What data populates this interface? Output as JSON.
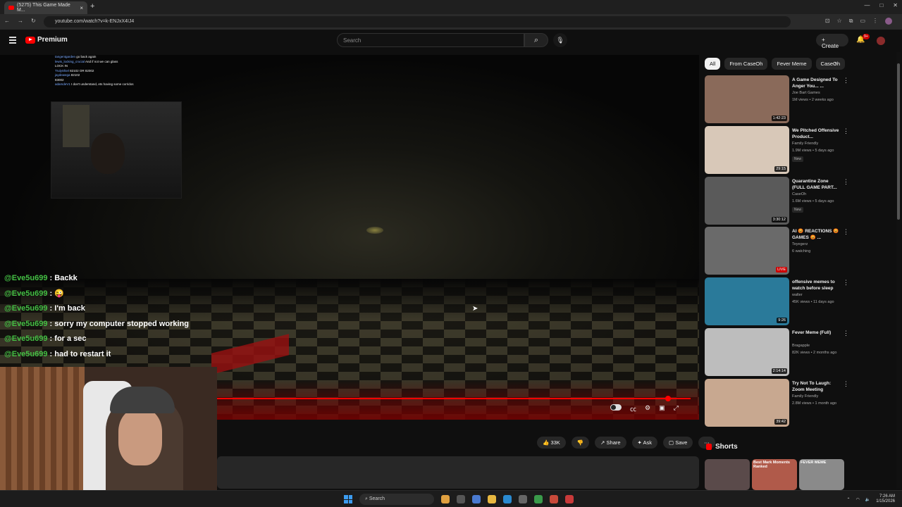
{
  "browser": {
    "tab_title": "(5275) This Game Made M...",
    "url": "youtube.com/watch?v=k-ENJxX4IJ4"
  },
  "header": {
    "logo_text": "Premium",
    "search_placeholder": "Search",
    "create_label": "Create",
    "notif_count": "9+"
  },
  "stream_chat_small": [
    {
      "user": "tangentgarden",
      "msg": "go back again"
    },
    {
      "user": "lewis_locking_crucial",
      "msg": "And if not we can glass"
    },
    {
      "user": "",
      "msg": "LOCK IN"
    },
    {
      "user": "TrulyShiel",
      "msg": "82102 OR 82002"
    },
    {
      "user": "jaydewega",
      "msg": "82102"
    },
    {
      "user": "",
      "msg": "83002"
    },
    {
      "user": "adamdeV1",
      "msg": "I don't understand, ets having some corridos"
    }
  ],
  "chat": [
    {
      "user": "@Eve5u699",
      "msg": "Backk"
    },
    {
      "user": "@Eve5u699",
      "msg": "😜"
    },
    {
      "user": "@Eve5u699",
      "msg": "I'm back"
    },
    {
      "user": "@Eve5u699",
      "msg": "sorry my computer stopped working"
    },
    {
      "user": "@Eve5u699",
      "msg": "for a sec"
    },
    {
      "user": "@Eve5u699",
      "msg": "had to restart it"
    }
  ],
  "actions": {
    "likes": "33K",
    "share": "Share",
    "ask": "Ask",
    "save": "Save"
  },
  "chips": [
    "All",
    "From CaseOh",
    "Fever Meme",
    "CaseOh"
  ],
  "recommendations": [
    {
      "title": "A Game Designed To Anger You... ...",
      "channel": "Joe Bart Games",
      "meta": "1M views • 2 weeks ago",
      "duration": "1:42:23",
      "new": false,
      "live": false,
      "thumb": "#8a6a5a"
    },
    {
      "title": "We Pitched Offensive Product...",
      "channel": "Family Friendly",
      "meta": "1.9M views • 5 days ago",
      "duration": "29:15",
      "new": true,
      "live": false,
      "thumb": "#d8c8b8"
    },
    {
      "title": "Quarantine Zone (FULL GAME PART...",
      "channel": "CaseOh",
      "meta": "1.6M views • 5 days ago",
      "duration": "3:30:12",
      "new": true,
      "live": false,
      "thumb": "#5a5a5a"
    },
    {
      "title": "AI 😡 REACTIONS 😡 GAMES 😡 ...",
      "channel": "Teyegerz",
      "meta": "6 watching",
      "duration": "LIVE",
      "new": false,
      "live": true,
      "thumb": "#6a6a6a"
    },
    {
      "title": "offensive memes to watch before sleep",
      "channel": "walter",
      "meta": "45K views • 11 days ago",
      "duration": "9:26",
      "new": false,
      "live": false,
      "thumb": "#2a7a9a"
    },
    {
      "title": "Fever Meme (Full)",
      "channel": "Bragapple",
      "meta": "82K views • 2 months ago",
      "duration": "2:14:14",
      "new": false,
      "live": false,
      "thumb": "#bdbdbd"
    },
    {
      "title": "Try Not To Laugh: Zoom Meeting",
      "channel": "Family Friendly",
      "meta": "2.8M views • 1 month ago",
      "duration": "39:42",
      "new": false,
      "live": false,
      "thumb": "#c8a890"
    }
  ],
  "shorts": {
    "title": "Shorts",
    "items": [
      {
        "caption": "",
        "color": "#5a4a4a"
      },
      {
        "caption": "Best Mark Moments Ranked",
        "color": "#b05a4a"
      },
      {
        "caption": "FEVER MEME",
        "color": "#8a8a8a"
      }
    ]
  },
  "taskbar": {
    "search_label": "Search",
    "time": "7:26 AM",
    "date": "1/15/2026"
  },
  "colors": {
    "accent": "#ff0000",
    "chat_user": "#44c044"
  }
}
